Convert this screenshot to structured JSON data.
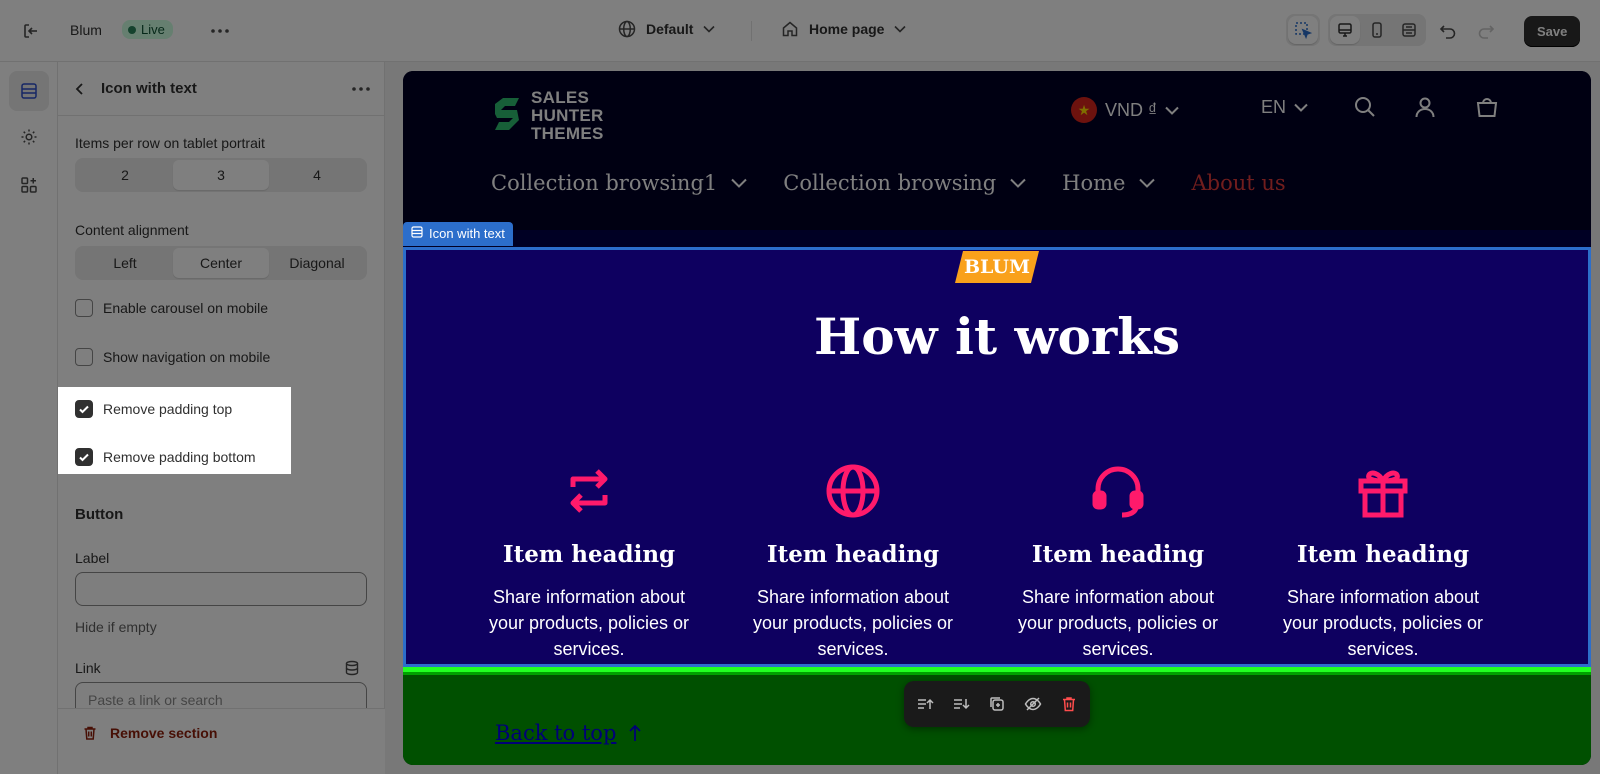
{
  "topbar": {
    "store_name": "Blum",
    "status_badge": "Live",
    "theme_select": "Default",
    "page_select": "Home page",
    "save_label": "Save"
  },
  "panel": {
    "title": "Icon with text",
    "items_per_row_label": "Items per row on tablet portrait",
    "items_per_row_options": [
      "2",
      "3",
      "4"
    ],
    "items_per_row_selected": "3",
    "content_alignment_label": "Content alignment",
    "content_alignment_options": [
      "Left",
      "Center",
      "Diagonal"
    ],
    "content_alignment_selected": "Center",
    "checkboxes": [
      {
        "label": "Enable carousel on mobile",
        "checked": false
      },
      {
        "label": "Show navigation on mobile",
        "checked": false
      },
      {
        "label": "Remove padding top",
        "checked": true
      },
      {
        "label": "Remove padding bottom",
        "checked": true
      }
    ],
    "button_section": "Button",
    "label_field_label": "Label",
    "label_field_value": "",
    "label_field_help": "Hide if empty",
    "link_field_label": "Link",
    "link_field_placeholder": "Paste a link or search",
    "remove_section": "Remove section"
  },
  "preview": {
    "logo_text": "SALES HUNTER THEMES",
    "currency": "VND ₫",
    "language": "EN",
    "nav": [
      {
        "label": "Collection browsing1",
        "active": false
      },
      {
        "label": "Collection browsing",
        "active": false
      },
      {
        "label": "Home",
        "active": false
      },
      {
        "label": "About us",
        "active": true
      }
    ],
    "section_tag": "Icon with text",
    "badge": "BLUM",
    "heading": "How it works",
    "items": [
      {
        "icon": "exchange-icon",
        "heading": "Item heading",
        "body": "Share information about your products, policies or services."
      },
      {
        "icon": "globe-icon",
        "heading": "Item heading",
        "body": "Share information about your products, policies or services."
      },
      {
        "icon": "headset-icon",
        "heading": "Item heading",
        "body": "Share information about your products, policies or services."
      },
      {
        "icon": "gift-icon",
        "heading": "Item heading",
        "body": "Share information about your products, policies or services."
      }
    ],
    "back_to_top": "Back to top"
  },
  "colors": {
    "header_bg": "#000024",
    "section_bg": "#0e0060",
    "accent_pink": "#ff1a6b",
    "badge_orange": "#f9a11b",
    "footer_green": "#00a000",
    "nav_active": "#e23b3b",
    "selection_blue": "#2c6ecb"
  }
}
